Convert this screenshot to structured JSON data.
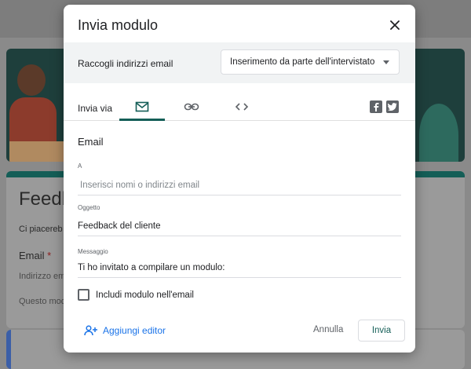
{
  "background": {
    "form_title": "Feedb",
    "form_desc": "Ci piacereb",
    "email_label": "Email",
    "required_mark": "*",
    "email_hint": "Indirizzo em",
    "form_note": "Questo mod"
  },
  "dialog": {
    "title": "Invia modulo",
    "close_icon": "close-icon",
    "collect": {
      "label": "Raccogli indirizzi email",
      "selected": "Inserimento da parte dell'intervistato"
    },
    "send_via": "Invia via",
    "tabs": [
      {
        "name": "email",
        "icon": "mail-icon",
        "active": true
      },
      {
        "name": "link",
        "icon": "link-icon",
        "active": false
      },
      {
        "name": "embed",
        "icon": "code-icon",
        "active": false
      }
    ],
    "email_section": "Email",
    "to": {
      "label": "A",
      "placeholder": "Inserisci nomi o indirizzi email"
    },
    "subject": {
      "label": "Oggetto",
      "value": "Feedback del cliente"
    },
    "message": {
      "label": "Messaggio",
      "value": "Ti ho invitato a compilare un modulo:"
    },
    "include_form": "Includi modulo nell'email",
    "add_editors": "Aggiungi editor",
    "cancel": "Annulla",
    "send": "Invia"
  },
  "colors": {
    "accent": "#145e57",
    "link": "#1a73e8"
  }
}
